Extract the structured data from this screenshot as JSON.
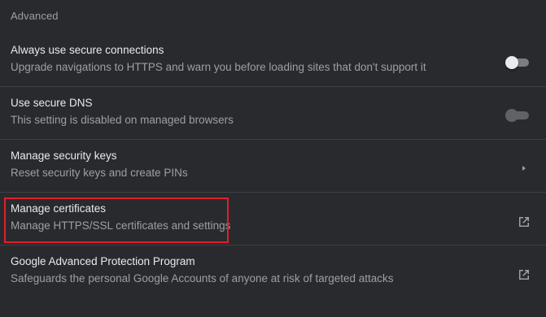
{
  "section": {
    "title": "Advanced"
  },
  "rows": [
    {
      "title": "Always use secure connections",
      "description": "Upgrade navigations to HTTPS and warn you before loading sites that don't support it",
      "control": "toggle",
      "state": "off"
    },
    {
      "title": "Use secure DNS",
      "description": "This setting is disabled on managed browsers",
      "control": "toggle",
      "state": "disabled"
    },
    {
      "title": "Manage security keys",
      "description": "Reset security keys and create PINs",
      "control": "arrow-right-icon"
    },
    {
      "title": "Manage certificates",
      "description": "Manage HTTPS/SSL certificates and settings",
      "control": "open-external-icon"
    },
    {
      "title": "Google Advanced Protection Program",
      "description": "Safeguards the personal Google Accounts of anyone at risk of targeted attacks",
      "control": "open-external-icon"
    }
  ],
  "colors": {
    "background": "#292a2d",
    "primary_text": "#e8eaed",
    "secondary_text": "#9aa0a6",
    "divider": "#3f4043",
    "highlight": "#e0202b"
  }
}
